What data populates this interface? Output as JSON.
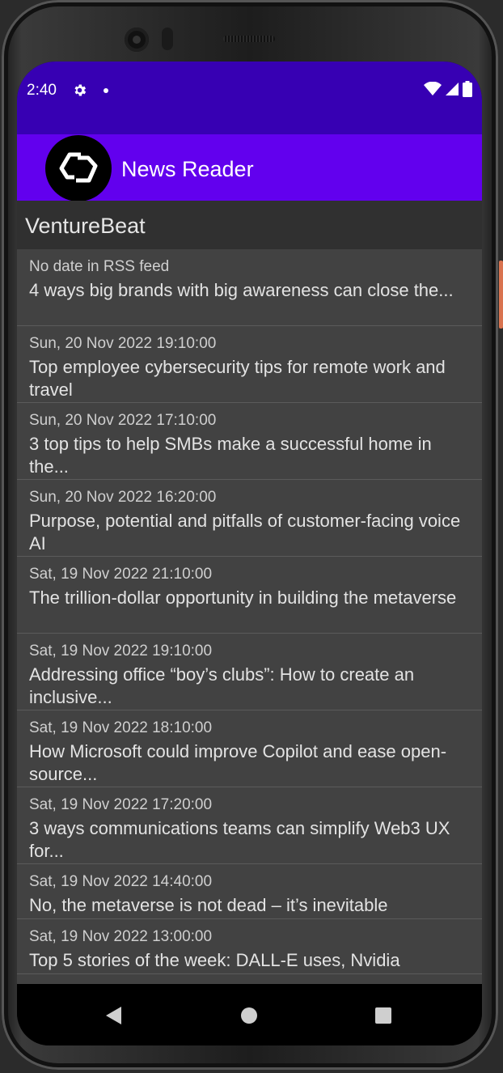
{
  "status_bar": {
    "time": "2:40"
  },
  "app_bar": {
    "title": "News Reader"
  },
  "feed": {
    "name": "VentureBeat"
  },
  "articles": [
    {
      "date": "No date in RSS feed",
      "title": "4 ways big brands with big awareness can close the..."
    },
    {
      "date": "Sun, 20 Nov 2022 19:10:00",
      "title": "Top employee cybersecurity tips for remote work and travel"
    },
    {
      "date": "Sun, 20 Nov 2022 17:10:00",
      "title": "3 top tips to help SMBs make a successful home in the..."
    },
    {
      "date": "Sun, 20 Nov 2022 16:20:00",
      "title": "Purpose, potential and pitfalls of customer-facing voice AI"
    },
    {
      "date": "Sat, 19 Nov 2022 21:10:00",
      "title": "The trillion-dollar opportunity in building the metaverse"
    },
    {
      "date": "Sat, 19 Nov 2022 19:10:00",
      "title": "Addressing office “boy’s clubs”: How to create an inclusive..."
    },
    {
      "date": "Sat, 19 Nov 2022 18:10:00",
      "title": "How Microsoft could improve Copilot and ease open-source..."
    },
    {
      "date": "Sat, 19 Nov 2022 17:20:00",
      "title": "3 ways communications teams can simplify Web3 UX for..."
    },
    {
      "date": "Sat, 19 Nov 2022 14:40:00",
      "title": "No, the metaverse is not dead – it’s inevitable"
    },
    {
      "date": "Sat, 19 Nov 2022 13:00:00",
      "title": "Top 5 stories of the week: DALL-E uses, Nvidia"
    }
  ],
  "colors": {
    "status_bar": "#3700b3",
    "app_bar": "#6200ee",
    "feed_header": "#303030",
    "list_background": "#424242"
  },
  "icons": {
    "settings": "gear-icon",
    "notification": "dot-icon",
    "wifi": "wifi-icon",
    "signal": "signal-icon",
    "battery": "battery-icon",
    "app_logo": "cd-logo",
    "nav_back": "back-icon",
    "nav_home": "home-icon",
    "nav_recents": "recents-icon"
  }
}
